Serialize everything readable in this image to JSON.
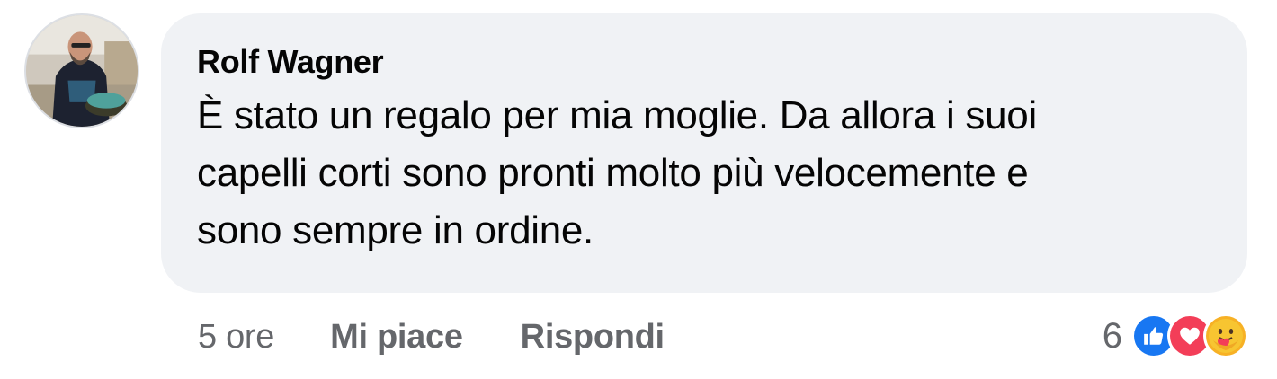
{
  "comment": {
    "author": "Rolf Wagner",
    "text_lines": [
      "È stato un regalo per mia moglie. Da allora i suoi",
      "capelli corti sono pronti molto più velocemente e",
      "sono sempre in ordine."
    ]
  },
  "actions": {
    "time": "5 ore",
    "like_label": "Mi piace",
    "reply_label": "Rispondi"
  },
  "reactions": {
    "count": "6",
    "icons": [
      "like-icon",
      "love-icon",
      "care-icon"
    ],
    "colors": {
      "like": "#1877f2",
      "love": "#f33e58",
      "care": "#f7b125"
    }
  },
  "colors": {
    "bubble_bg": "#f0f2f5",
    "text": "#050505",
    "secondary_text": "#65676b"
  }
}
